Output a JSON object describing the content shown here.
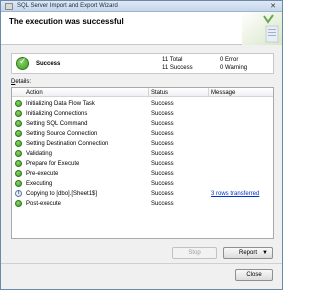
{
  "window": {
    "title": "SQL Server Import and Export Wizard"
  },
  "header": {
    "title": "The execution was successful"
  },
  "summary": {
    "status": "Success",
    "total": "11 Total",
    "success": "11 Success",
    "error": "0 Error",
    "warning": "0 Warning"
  },
  "details": {
    "label_accel": "D",
    "label_rest": "etails:",
    "columns": {
      "action": "Action",
      "status": "Status",
      "message": "Message"
    },
    "rows": [
      {
        "icon": "success-icon",
        "action": "Initializing Data Flow Task",
        "status": "Success",
        "message": ""
      },
      {
        "icon": "success-icon",
        "action": "Initializing Connections",
        "status": "Success",
        "message": ""
      },
      {
        "icon": "success-icon",
        "action": "Setting SQL Command",
        "status": "Success",
        "message": ""
      },
      {
        "icon": "success-icon",
        "action": "Setting Source Connection",
        "status": "Success",
        "message": ""
      },
      {
        "icon": "success-icon",
        "action": "Setting Destination Connection",
        "status": "Success",
        "message": ""
      },
      {
        "icon": "success-icon",
        "action": "Validating",
        "status": "Success",
        "message": ""
      },
      {
        "icon": "success-icon",
        "action": "Prepare for Execute",
        "status": "Success",
        "message": ""
      },
      {
        "icon": "success-icon",
        "action": "Pre-execute",
        "status": "Success",
        "message": ""
      },
      {
        "icon": "success-icon",
        "action": "Executing",
        "status": "Success",
        "message": ""
      },
      {
        "icon": "info-icon",
        "action": "Copying to [dbo].[Sheet1$]",
        "status": "Success",
        "message": "3 rows transferred"
      },
      {
        "icon": "success-icon",
        "action": "Post-execute",
        "status": "Success",
        "message": ""
      }
    ]
  },
  "buttons": {
    "stop": "Stop",
    "report": "Report",
    "close": "Close"
  },
  "colors": {
    "success": "#3b9a23",
    "link": "#0033cc"
  }
}
